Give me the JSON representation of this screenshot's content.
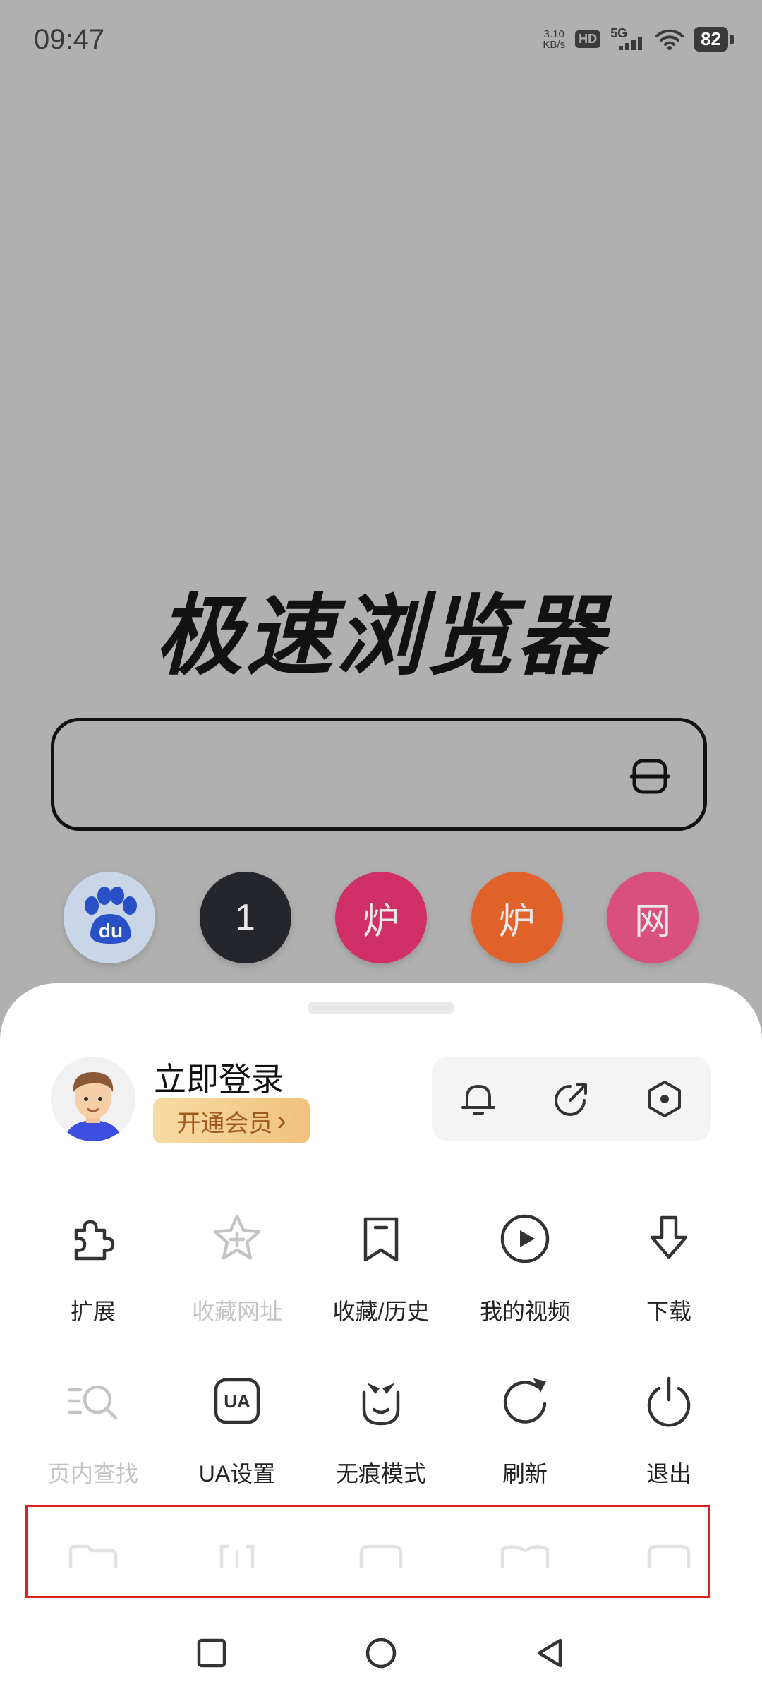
{
  "status_bar": {
    "time": "09:47",
    "net_speed_value": "3.10",
    "net_speed_unit": "KB/s",
    "hd": "HD",
    "network": "5G",
    "battery": "82"
  },
  "browser": {
    "title": "极速浏览器",
    "search_placeholder": ""
  },
  "quick_links": [
    {
      "label": "du",
      "color": "#c8d6e8"
    },
    {
      "label": "1",
      "color": "#25262c"
    },
    {
      "label": "炉",
      "color": "#d02f68"
    },
    {
      "label": "炉",
      "color": "#e0622a"
    },
    {
      "label": "网",
      "color": "#d94f7e"
    }
  ],
  "menu": {
    "account": {
      "login_label": "立即登录",
      "vip_label": "开通会员",
      "vip_chevron": "›"
    },
    "actions": [
      "bell-icon",
      "share-icon",
      "settings-icon"
    ],
    "row1": [
      {
        "label": "扩展",
        "icon": "puzzle-icon",
        "enabled": true
      },
      {
        "label": "收藏网址",
        "icon": "star-add-icon",
        "enabled": false
      },
      {
        "label": "收藏/历史",
        "icon": "bookmark-icon",
        "enabled": true
      },
      {
        "label": "我的视频",
        "icon": "play-icon",
        "enabled": true
      },
      {
        "label": "下载",
        "icon": "download-icon",
        "enabled": true
      }
    ],
    "row2": [
      {
        "label": "页内查找",
        "icon": "find-in-page-icon",
        "enabled": false
      },
      {
        "label": "UA设置",
        "icon": "ua-icon",
        "enabled": true
      },
      {
        "label": "无痕模式",
        "icon": "incognito-icon",
        "enabled": true
      },
      {
        "label": "刷新",
        "icon": "refresh-icon",
        "enabled": true
      },
      {
        "label": "退出",
        "icon": "power-icon",
        "enabled": true
      }
    ],
    "ua_text": "UA"
  },
  "colors": {
    "overlay_bg": "#b0b0b0",
    "vip_text": "#a05a1e",
    "highlight": "#e02020"
  }
}
